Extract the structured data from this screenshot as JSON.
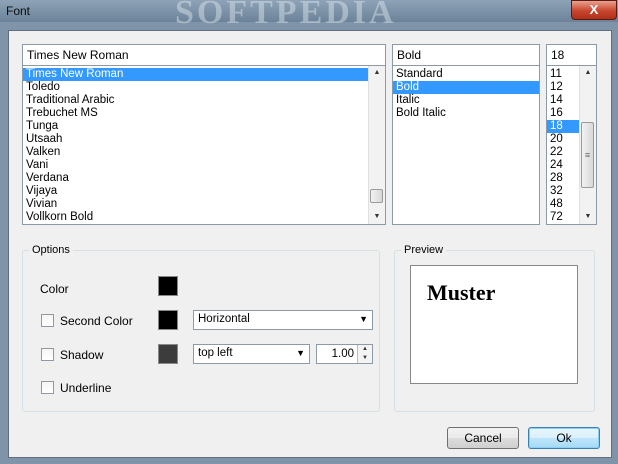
{
  "window": {
    "title": "Font",
    "watermark": "SOFTPEDIA",
    "close_glyph": "X"
  },
  "font_name": {
    "value": "Times New Roman",
    "items": [
      "Times New Roman",
      "Toledo",
      "Traditional Arabic",
      "Trebuchet MS",
      "Tunga",
      "Utsaah",
      "Valken",
      "Vani",
      "Verdana",
      "Vijaya",
      "Vivian",
      "Vollkorn Bold"
    ],
    "selected_index": 0
  },
  "font_style": {
    "value": "Bold",
    "items": [
      "Standard",
      "Bold",
      "Italic",
      "Bold Italic"
    ],
    "selected_index": 1
  },
  "font_size": {
    "value": "18",
    "items": [
      "11",
      "12",
      "14",
      "16",
      "18",
      "20",
      "22",
      "24",
      "28",
      "32",
      "48",
      "72"
    ],
    "selected_index": 4
  },
  "options": {
    "group_label": "Options",
    "color_label": "Color",
    "color_value": "#000000",
    "second_color_label": "Second Color",
    "second_color_value": "#000000",
    "second_color_mode": "Horizontal",
    "shadow_label": "Shadow",
    "shadow_color_value": "#3c3c3c",
    "shadow_position": "top left",
    "shadow_size": "1.00",
    "underline_label": "Underline"
  },
  "preview": {
    "group_label": "Preview",
    "sample_text": "Muster"
  },
  "buttons": {
    "cancel": "Cancel",
    "ok": "Ok"
  },
  "icons": {
    "scroll_up": "▲",
    "scroll_down": "▼",
    "dropdown": "▼",
    "grip": "≡"
  }
}
